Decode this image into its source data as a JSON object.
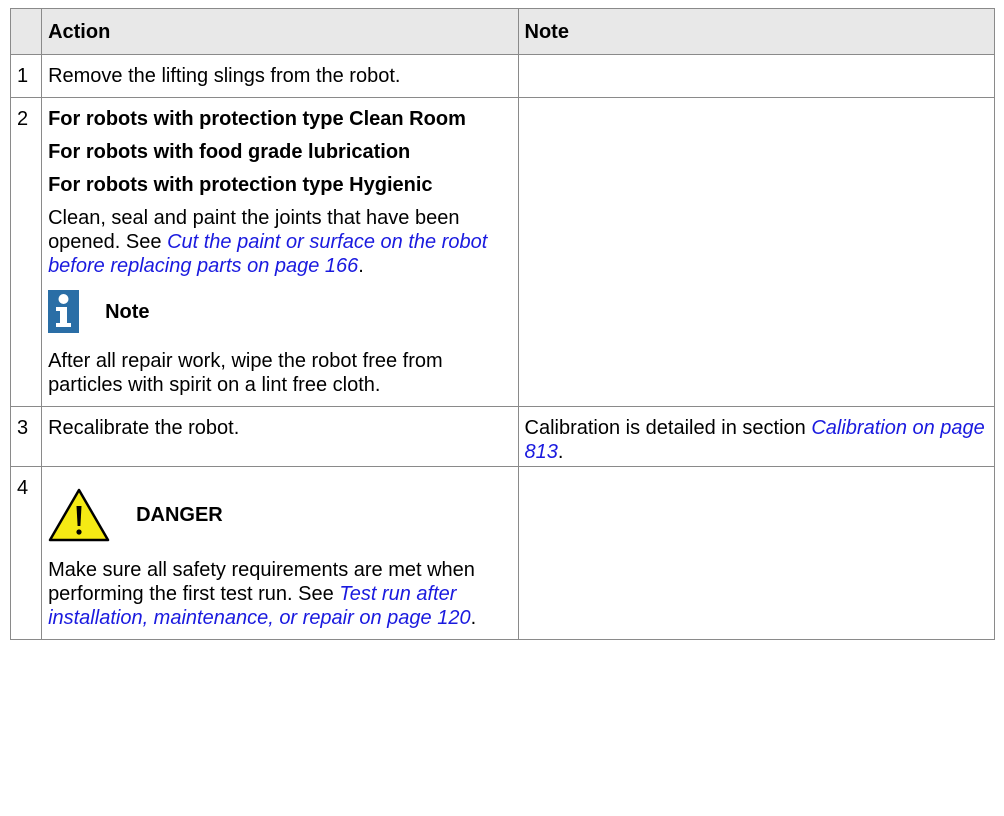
{
  "table": {
    "headers": {
      "number": "",
      "action": "Action",
      "note": "Note"
    },
    "rows": [
      {
        "number": "1",
        "action_text": "Remove the lifting slings from the robot.",
        "note": ""
      },
      {
        "number": "2",
        "bold_lines": [
          "For robots with protection type Clean Room",
          "For robots with food grade lubrication",
          "For robots with protection type Hygienic"
        ],
        "para_prefix": "Clean, seal and paint the joints that have been opened. See ",
        "para_link": "Cut the paint or surface on the robot before replacing parts on page 166",
        "para_suffix": ".",
        "admonition_title": "Note",
        "admonition_icon": "info-note-icon",
        "after_admonition": "After all repair work, wipe the robot free from particles with spirit on a lint free cloth.",
        "note": ""
      },
      {
        "number": "3",
        "action_text": "Recalibrate the robot.",
        "note_prefix": "Calibration is detailed in section ",
        "note_link": "Calibration on page 813",
        "note_suffix": "."
      },
      {
        "number": "4",
        "admonition_title": "DANGER",
        "admonition_icon": "warning-triangle-icon",
        "para_prefix": "Make sure all safety requirements are met when performing the first test run. See ",
        "para_link": "Test run after installation, maintenance, or repair on page 120",
        "para_suffix": ".",
        "note": ""
      }
    ]
  },
  "colors": {
    "link": "#1a1adf",
    "note_icon": "#2a6ea6",
    "warning_fill": "#f5ea14",
    "header_bg": "#e8e8e8"
  }
}
